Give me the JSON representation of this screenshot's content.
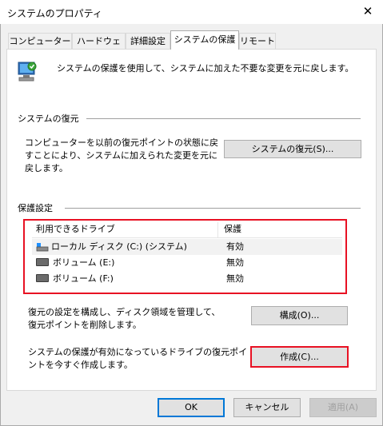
{
  "window": {
    "title": "システムのプロパティ"
  },
  "tabs": [
    {
      "label": "コンピューター名"
    },
    {
      "label": "ハードウェア"
    },
    {
      "label": "詳細設定"
    },
    {
      "label": "システムの保護"
    },
    {
      "label": "リモート"
    }
  ],
  "intro": "システムの保護を使用して、システムに加えた不要な変更を元に戻します。",
  "restore": {
    "section_title": "システムの復元",
    "description": "コンピューターを以前の復元ポイントの状態に戻すことにより、システムに加えられた変更を元に戻します。",
    "button_label": "システムの復元(S)..."
  },
  "protection": {
    "section_title": "保護設定",
    "columns": {
      "drive": "利用できるドライブ",
      "protection": "保護"
    },
    "drives": [
      {
        "name": "ローカル ディスク (C:) (システム)",
        "status": "有効"
      },
      {
        "name": "ボリューム (E:)",
        "status": "無効"
      },
      {
        "name": "ボリューム (F:)",
        "status": "無効"
      }
    ],
    "configure_description": "復元の設定を構成し、ディスク領域を管理して、復元ポイントを削除します。",
    "configure_button": "構成(O)...",
    "create_description": "システムの保護が有効になっているドライブの復元ポイントを今すぐ作成します。",
    "create_button": "作成(C)..."
  },
  "footer": {
    "ok": "OK",
    "cancel": "キャンセル",
    "apply": "適用(A)"
  },
  "colors": {
    "highlight_border": "#e81123",
    "accent": "#0078d7"
  }
}
